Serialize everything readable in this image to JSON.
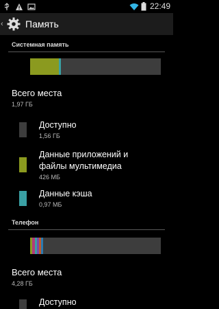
{
  "status": {
    "time": "22:49",
    "left_icons": [
      "usb-icon",
      "warning-icon",
      "image-icon"
    ],
    "right_icons": [
      "wifi-icon",
      "battery-icon"
    ]
  },
  "action_bar": {
    "title": "Память",
    "icon": "settings-gear-icon"
  },
  "system_section": {
    "header": "Системная память",
    "usage": [
      {
        "name": "apps",
        "color": "#8b9a1f",
        "fraction": 0.22
      },
      {
        "name": "cache",
        "color": "#3aa0a4",
        "fraction": 0.015
      }
    ],
    "total_label": "Всего места",
    "total_value": "1,97 ГБ",
    "items": [
      {
        "title": "Доступно",
        "value": "1,56 ГБ",
        "color": "#3d3d3d"
      },
      {
        "title": "Данные приложений и файлы мультимедиа",
        "title_line1": "Данные приложений и",
        "title_line2": "файлы мультимедиа",
        "value": "426 МБ",
        "color": "#8b9a1f"
      },
      {
        "title": "Данные кэша",
        "value": "0,97 МБ",
        "color": "#3aa0a4"
      }
    ]
  },
  "phone_section": {
    "header": "Телефон",
    "usage": [
      {
        "name": "seg1",
        "color": "#8b9a1f",
        "fraction": 0.015
      },
      {
        "name": "seg2",
        "color": "#b23b7a",
        "fraction": 0.02
      },
      {
        "name": "seg3",
        "color": "#3aa0a4",
        "fraction": 0.015
      },
      {
        "name": "seg4",
        "color": "#7a4aa8",
        "fraction": 0.02
      },
      {
        "name": "seg5",
        "color": "#c05a2a",
        "fraction": 0.015
      },
      {
        "name": "seg6",
        "color": "#2a7ab0",
        "fraction": 0.015
      }
    ],
    "total_label": "Всего места",
    "total_value": "4,28 ГБ",
    "items": [
      {
        "title": "Доступно",
        "color": "#3d3d3d"
      }
    ]
  }
}
